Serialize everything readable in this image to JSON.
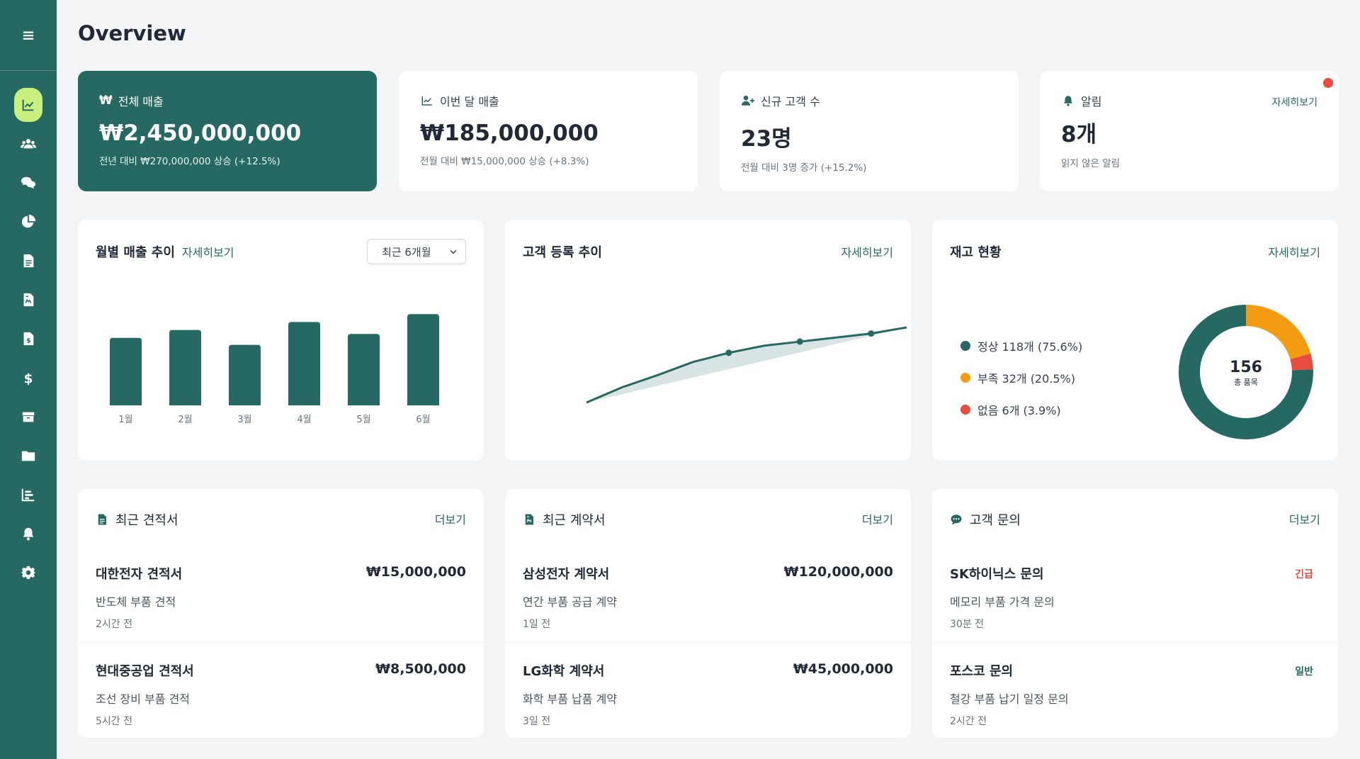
{
  "page": {
    "title": "Overview"
  },
  "sidebar": {
    "items": [
      {
        "icon": "chart-line-icon",
        "active": true
      },
      {
        "icon": "users-icon"
      },
      {
        "icon": "comments-icon"
      },
      {
        "icon": "pie-chart-icon"
      },
      {
        "icon": "file-lines-icon"
      },
      {
        "icon": "file-contract-icon"
      },
      {
        "icon": "file-invoice-dollar-icon"
      },
      {
        "icon": "dollar-icon"
      },
      {
        "icon": "box-icon"
      },
      {
        "icon": "folder-icon"
      },
      {
        "icon": "bar-chart-icon"
      },
      {
        "icon": "bell-icon"
      },
      {
        "icon": "gear-icon"
      }
    ]
  },
  "stats": {
    "revenue": {
      "label": "전체 매출",
      "value": "₩2,450,000,000",
      "sub": "전년 대비 ₩270,000,000 상승 (+12.5%)"
    },
    "monthly": {
      "label": "이번 달 매출",
      "value": "₩185,000,000",
      "sub": "전월 대비 ₩15,000,000 상승 (+8.3%)"
    },
    "customers": {
      "label": "신규 고객 수",
      "value": "23명",
      "sub": "전월 대비 3명 증가 (+15.2%)"
    },
    "alerts": {
      "label": "알림",
      "value": "8개",
      "sub": "읽지 않은 알림",
      "link": "자세히보기"
    }
  },
  "panels": {
    "monthly_sales": {
      "title": "월별 매출 추이",
      "link": "자세히보기",
      "select": "최근 6개월"
    },
    "customer_trend": {
      "title": "고객 등록 추이",
      "link": "자세히보기"
    },
    "inventory": {
      "title": "재고 현황",
      "link": "자세히보기",
      "legend": [
        "정상 118개 (75.6%)",
        "부족 32개 (20.5%)",
        "없음 6개 (3.9%)"
      ],
      "center_value": "156",
      "center_label": "총 품목"
    }
  },
  "quotes": {
    "title": "최근 견적서",
    "link": "더보기",
    "items": [
      {
        "title": "대한전자 견적서",
        "desc": "반도체 부품 견적",
        "time": "2시간 전",
        "amount": "₩15,000,000"
      },
      {
        "title": "현대중공업 견적서",
        "desc": "조선 장비 부품 견적",
        "time": "5시간 전",
        "amount": "₩8,500,000"
      }
    ]
  },
  "contracts": {
    "title": "최근 계약서",
    "link": "더보기",
    "items": [
      {
        "title": "삼성전자 계약서",
        "desc": "연간 부품 공급 계약",
        "time": "1일 전",
        "amount": "₩120,000,000"
      },
      {
        "title": "LG화학 계약서",
        "desc": "화학 부품 납품 계약",
        "time": "3일 전",
        "amount": "₩45,000,000"
      }
    ]
  },
  "inquiries": {
    "title": "고객 문의",
    "link": "더보기",
    "items": [
      {
        "title": "SK하이닉스 문의",
        "desc": "메모리 부품 가격 문의",
        "time": "30분 전",
        "tag": "긴급"
      },
      {
        "title": "포스코 문의",
        "desc": "철강 부품 납기 일정 문의",
        "time": "2시간 전",
        "tag": "일반"
      }
    ]
  },
  "chart_data": [
    {
      "type": "bar",
      "categories": [
        "1월",
        "2월",
        "3월",
        "4월",
        "5월",
        "6월"
      ],
      "values": [
        68,
        76,
        61,
        84,
        72,
        92
      ],
      "color": "#266962"
    },
    {
      "type": "area",
      "x": [
        1,
        2,
        3,
        4,
        5,
        6,
        7,
        8,
        9,
        10
      ],
      "values": [
        0,
        15,
        27,
        40,
        49,
        56,
        60,
        64,
        68,
        74
      ],
      "markers_at": [
        4,
        6,
        8
      ],
      "color": "#266962"
    },
    {
      "type": "pie",
      "labels": [
        "정상",
        "부족",
        "없음"
      ],
      "values": [
        118,
        32,
        6
      ],
      "colors": [
        "#266962",
        "#f39c12",
        "#e74c3c"
      ]
    }
  ]
}
